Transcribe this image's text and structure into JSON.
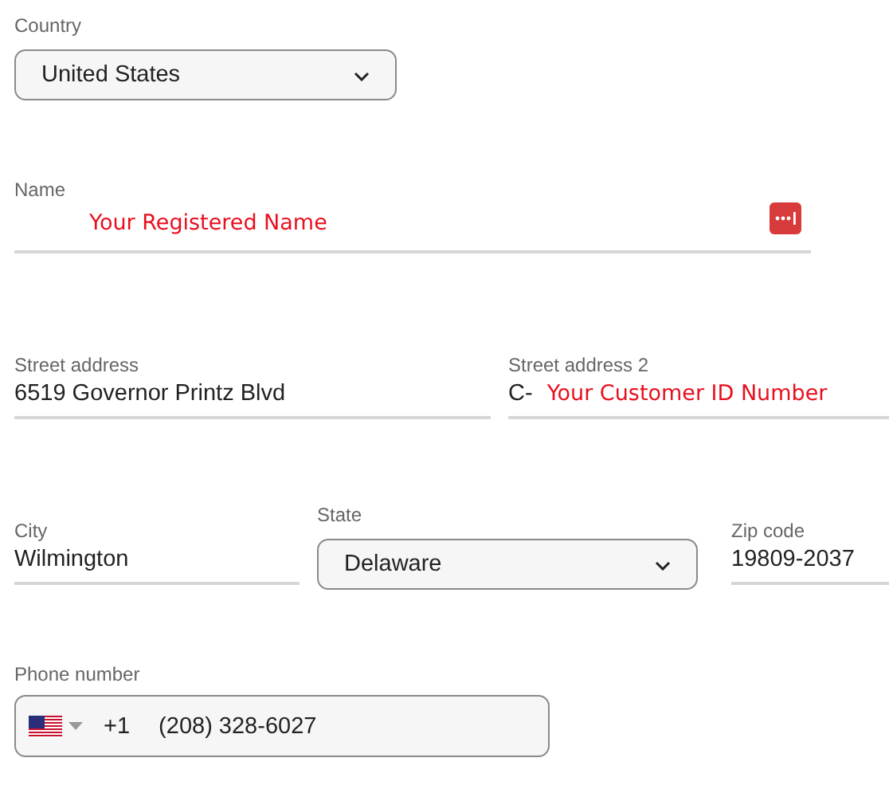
{
  "country": {
    "label": "Country",
    "value": "United States"
  },
  "name": {
    "label": "Name",
    "annotation": "Your Registered Name"
  },
  "street_address": {
    "label": "Street address",
    "value": "6519 Governor Printz Blvd"
  },
  "street_address_2": {
    "label": "Street address 2",
    "value": "C-",
    "annotation": "Your Customer ID Number"
  },
  "city": {
    "label": "City",
    "value": "Wilmington"
  },
  "state": {
    "label": "State",
    "value": "Delaware"
  },
  "zip_code": {
    "label": "Zip code",
    "value": "19809-2037"
  },
  "phone": {
    "label": "Phone number",
    "country_code": "+1",
    "value": "(208) 328-6027"
  }
}
